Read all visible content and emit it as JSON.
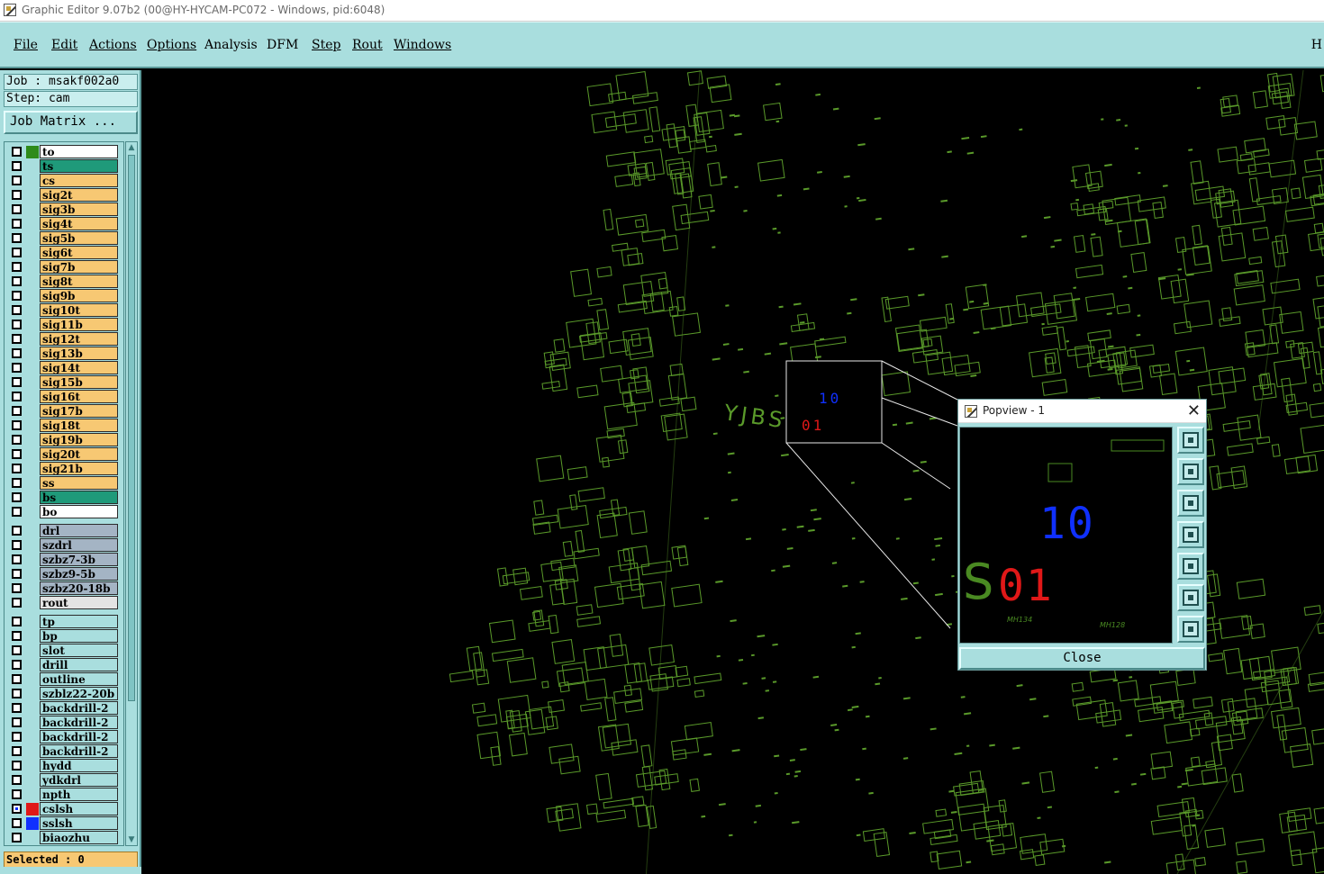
{
  "window": {
    "title": "Graphic Editor 9.07b2 (00@HY-HYCAM-PC072 - Windows, pid:6048)",
    "icon": "app-pen-icon"
  },
  "menubar": {
    "items": [
      "File",
      "Edit",
      "Actions",
      "Options",
      "Analysis",
      "DFM",
      "Step",
      "Rout",
      "Windows"
    ],
    "help": "H"
  },
  "job": {
    "job_label": "Job : msakf002a0",
    "step_label": "Step: cam",
    "matrix_button": "Job Matrix ..."
  },
  "layers": [
    {
      "name": "to",
      "bg": "#ffffff",
      "swatch": "#2e8b1a"
    },
    {
      "name": "ts",
      "bg": "#1f9a7a",
      "swatch": ""
    },
    {
      "name": "cs",
      "bg": "#f7c873",
      "swatch": ""
    },
    {
      "name": "sig2t",
      "bg": "#f7c873",
      "swatch": ""
    },
    {
      "name": "sig3b",
      "bg": "#f7c873",
      "swatch": ""
    },
    {
      "name": "sig4t",
      "bg": "#f7c873",
      "swatch": ""
    },
    {
      "name": "sig5b",
      "bg": "#f7c873",
      "swatch": ""
    },
    {
      "name": "sig6t",
      "bg": "#f7c873",
      "swatch": ""
    },
    {
      "name": "sig7b",
      "bg": "#f7c873",
      "swatch": ""
    },
    {
      "name": "sig8t",
      "bg": "#f7c873",
      "swatch": ""
    },
    {
      "name": "sig9b",
      "bg": "#f7c873",
      "swatch": ""
    },
    {
      "name": "sig10t",
      "bg": "#f7c873",
      "swatch": ""
    },
    {
      "name": "sig11b",
      "bg": "#f7c873",
      "swatch": ""
    },
    {
      "name": "sig12t",
      "bg": "#f7c873",
      "swatch": ""
    },
    {
      "name": "sig13b",
      "bg": "#f7c873",
      "swatch": ""
    },
    {
      "name": "sig14t",
      "bg": "#f7c873",
      "swatch": ""
    },
    {
      "name": "sig15b",
      "bg": "#f7c873",
      "swatch": ""
    },
    {
      "name": "sig16t",
      "bg": "#f7c873",
      "swatch": ""
    },
    {
      "name": "sig17b",
      "bg": "#f7c873",
      "swatch": ""
    },
    {
      "name": "sig18t",
      "bg": "#f7c873",
      "swatch": ""
    },
    {
      "name": "sig19b",
      "bg": "#f7c873",
      "swatch": ""
    },
    {
      "name": "sig20t",
      "bg": "#f7c873",
      "swatch": ""
    },
    {
      "name": "sig21b",
      "bg": "#f7c873",
      "swatch": ""
    },
    {
      "name": "ss",
      "bg": "#f7c873",
      "swatch": ""
    },
    {
      "name": "bs",
      "bg": "#1f9a7a",
      "swatch": ""
    },
    {
      "name": "bo",
      "bg": "#ffffff",
      "swatch": ""
    },
    {
      "name": "drl",
      "bg": "#a4b4c4",
      "swatch": ""
    },
    {
      "name": "szdrl",
      "bg": "#a4b4c4",
      "swatch": ""
    },
    {
      "name": "szbz7-3b",
      "bg": "#a4b4c4",
      "swatch": ""
    },
    {
      "name": "szbz9-5b",
      "bg": "#a4b4c4",
      "swatch": ""
    },
    {
      "name": "szbz20-18b",
      "bg": "#a4b4c4",
      "swatch": ""
    },
    {
      "name": "rout",
      "bg": "#e4e4e4",
      "swatch": ""
    },
    {
      "name": "tp",
      "bg": "#a9dede",
      "swatch": ""
    },
    {
      "name": "bp",
      "bg": "#a9dede",
      "swatch": ""
    },
    {
      "name": "slot",
      "bg": "#a9dede",
      "swatch": ""
    },
    {
      "name": "drill",
      "bg": "#a9dede",
      "swatch": ""
    },
    {
      "name": "outline",
      "bg": "#a9dede",
      "swatch": ""
    },
    {
      "name": "szblz22-20b",
      "bg": "#a9dede",
      "swatch": ""
    },
    {
      "name": "backdrill-2",
      "bg": "#a9dede",
      "swatch": ""
    },
    {
      "name": "backdrill-2",
      "bg": "#a9dede",
      "swatch": ""
    },
    {
      "name": "backdrill-2",
      "bg": "#a9dede",
      "swatch": ""
    },
    {
      "name": "backdrill-2",
      "bg": "#a9dede",
      "swatch": ""
    },
    {
      "name": "hydd",
      "bg": "#a9dede",
      "swatch": ""
    },
    {
      "name": "ydkdrl",
      "bg": "#a9dede",
      "swatch": ""
    },
    {
      "name": "npth",
      "bg": "#a9dede",
      "swatch": ""
    },
    {
      "name": "cslsh",
      "bg": "#a9dede",
      "swatch": "#e01818",
      "checked": true
    },
    {
      "name": "sslsh",
      "bg": "#a9dede",
      "swatch": "#1030ff"
    },
    {
      "name": "biaozhu",
      "bg": "#a9dede",
      "swatch": ""
    }
  ],
  "status": {
    "selected": "Selected : 0"
  },
  "canvas": {
    "trace_color": "#5a9a2a",
    "marker_text_left": "YJBS",
    "marker_red": "01",
    "marker_blue": "10"
  },
  "popview": {
    "title": "Popview - 1",
    "close_x": "✕",
    "close_button": "Close",
    "text_s": "S",
    "text_red": "01",
    "text_blue": "10",
    "label_a": "MH134",
    "label_b": "MH128",
    "tool_icons": [
      "zoom-fit-icon",
      "pan-up-icon",
      "pan-down-icon",
      "pan-left-icon",
      "pan-right-icon",
      "zoom-in-icon",
      "zoom-out-icon"
    ]
  }
}
